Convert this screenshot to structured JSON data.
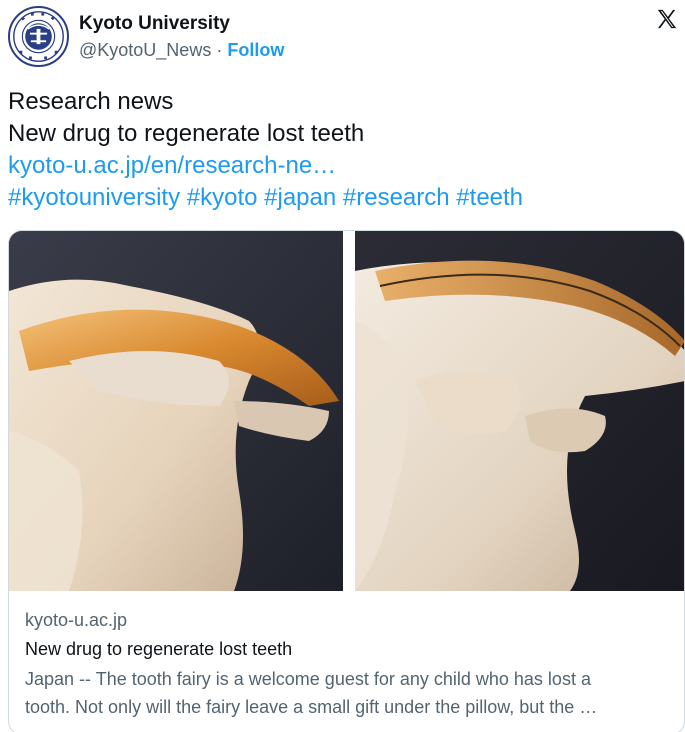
{
  "account": {
    "name": "Kyoto University",
    "handle": "@KyotoU_News",
    "separator": "·",
    "follow_label": "Follow",
    "avatar_icon": "kyoto-university-seal",
    "seal_text": "KYOTO UNIVERSITY FOUNDED 1897"
  },
  "tweet": {
    "line1": "Research news",
    "line2": "New drug to regenerate lost teeth",
    "link": "kyoto-u.ac.jp/en/research-ne…",
    "hashtags": [
      "#kyotouniversity",
      "#kyoto",
      "#japan",
      "#research",
      "#teeth"
    ]
  },
  "card": {
    "domain": "kyoto-u.ac.jp",
    "title": "New drug to regenerate lost teeth",
    "description_line1": "Japan -- The tooth fairy is a welcome guest for any child who has lost a",
    "description_line2": "tooth. Not only will the fairy leave a small gift under the pillow, but the …"
  },
  "icons": {
    "close": "x-logo-icon"
  },
  "colors": {
    "link": "#1d9bf0",
    "text": "#0f1419",
    "muted": "#536471",
    "border": "#cfd9de",
    "seal": "#2b3f86"
  }
}
